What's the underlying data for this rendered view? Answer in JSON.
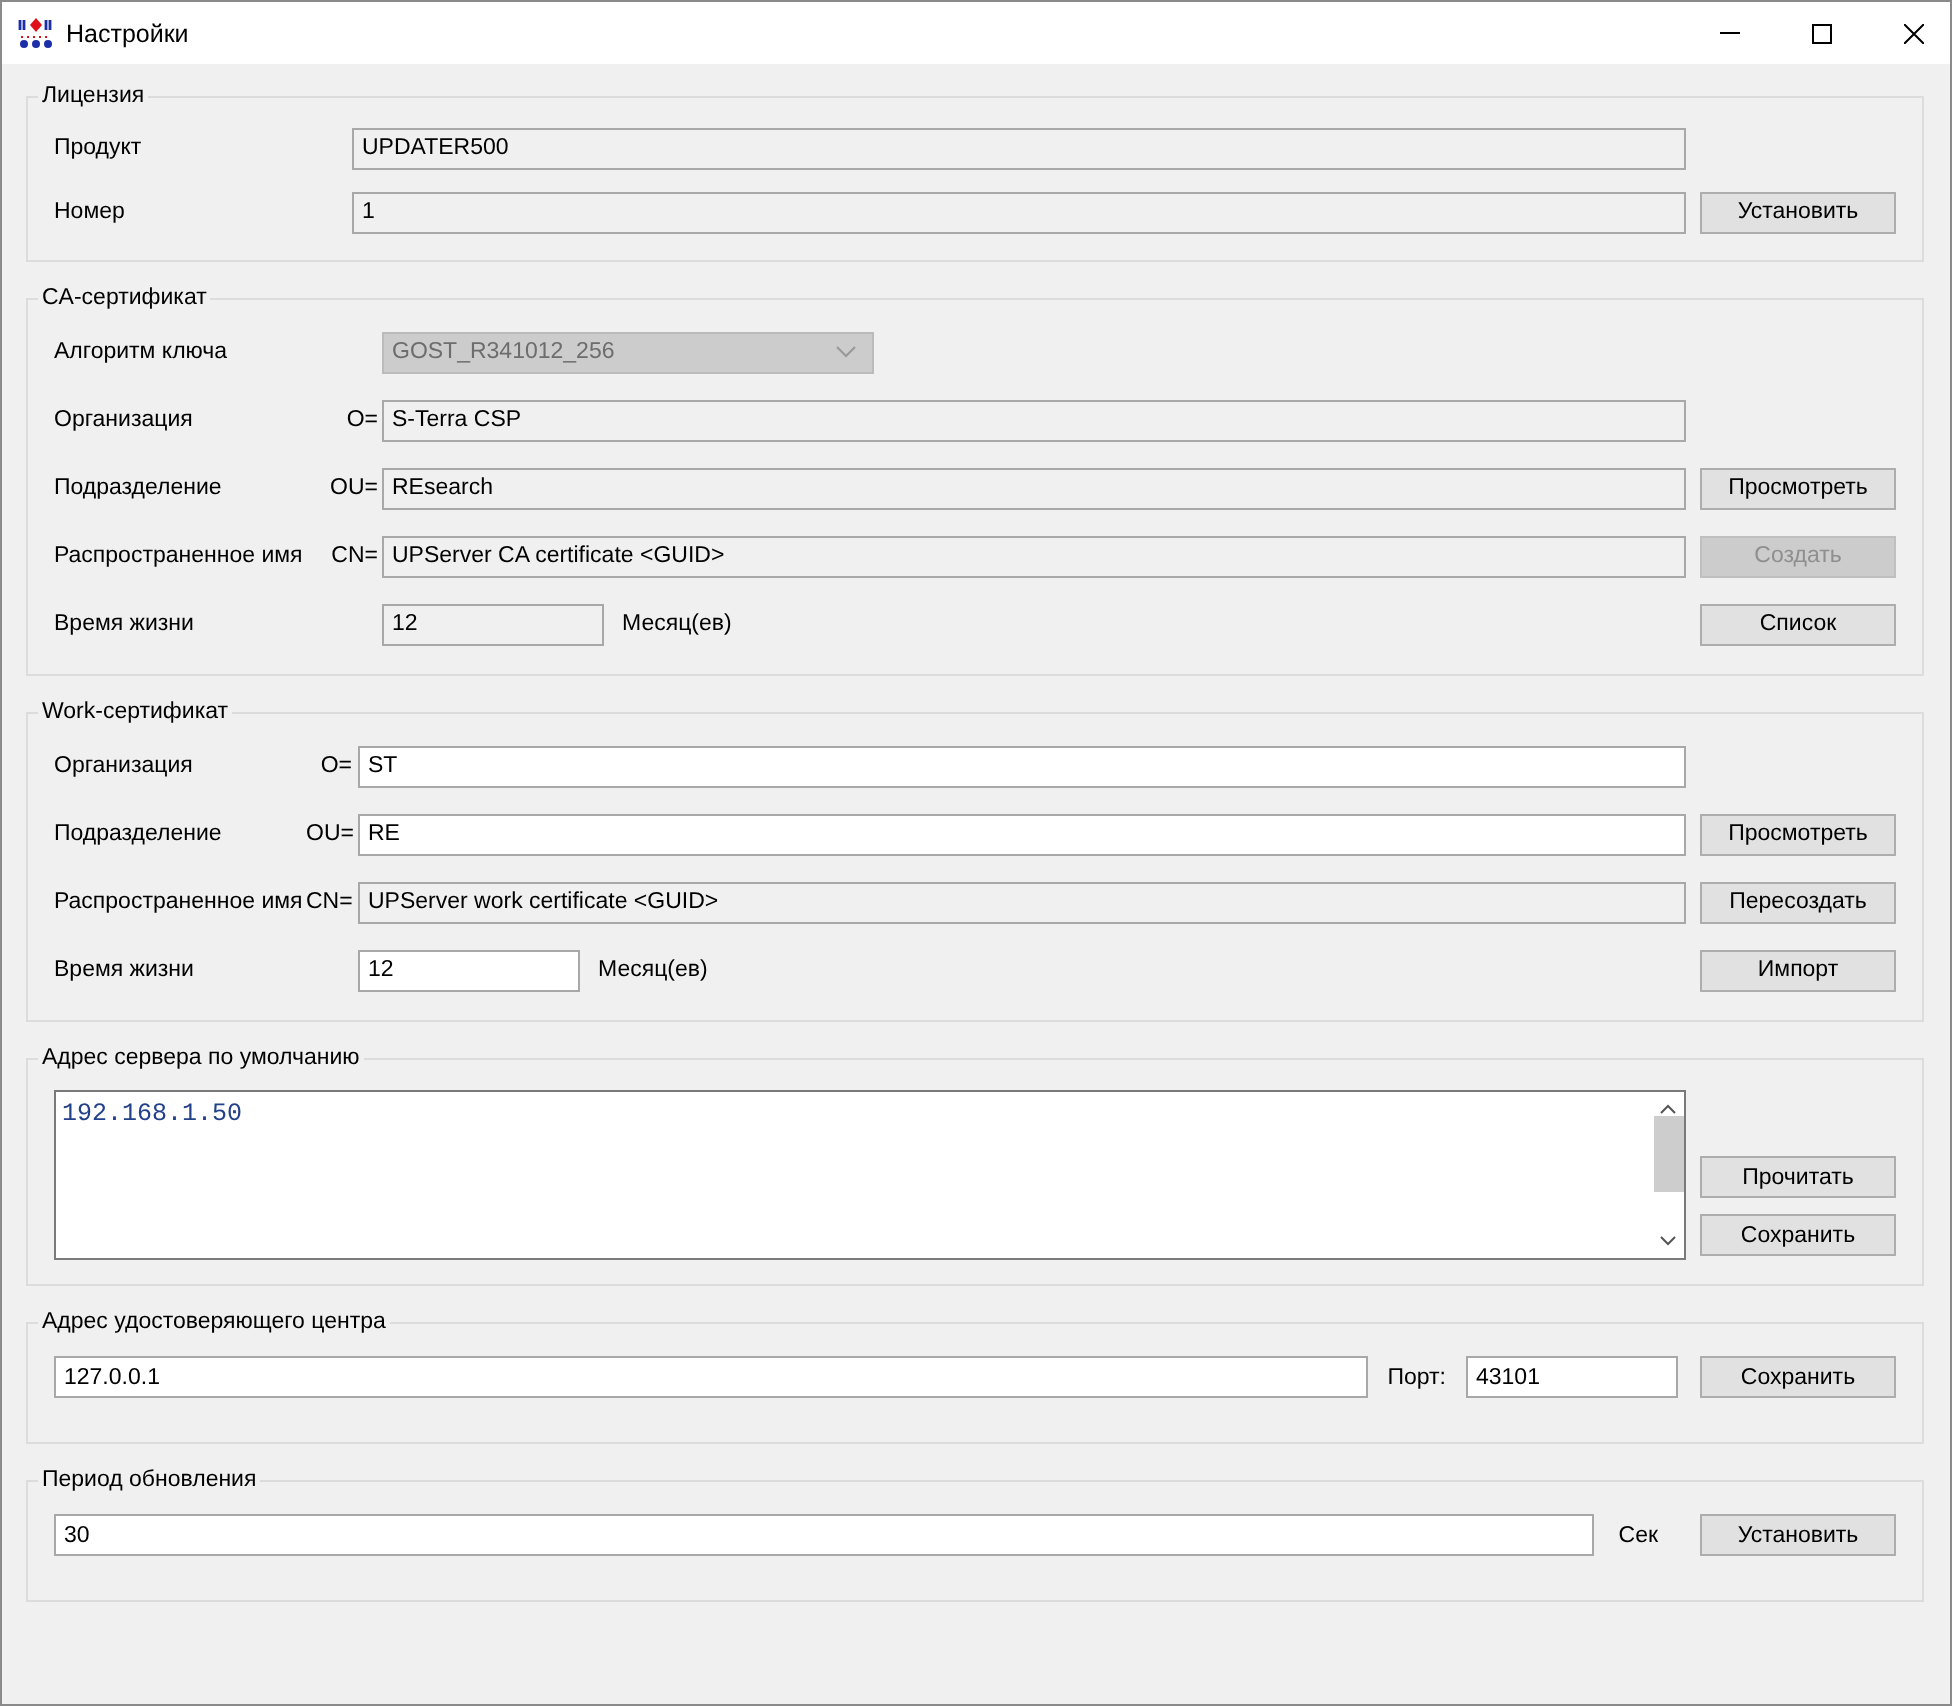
{
  "window": {
    "title": "Настройки"
  },
  "sections": [
    {
      "kind": "form",
      "title": "Лицензия",
      "rows": [
        {
          "label": "Продукт",
          "field": {
            "kind": "text",
            "value": "UPDATER500",
            "readonly": true
          }
        },
        {
          "label": "Номер",
          "field": {
            "kind": "text",
            "value": "1",
            "readonly": true
          },
          "button": {
            "label": "Установить",
            "disabled": false
          }
        }
      ]
    },
    {
      "kind": "form",
      "title": "CA-сертификат",
      "rows": [
        {
          "label": "Алгоритм ключа",
          "field": {
            "kind": "combo",
            "value": "GOST_R341012_256",
            "readonly": true
          }
        },
        {
          "label": "Организация",
          "prefix": "O=",
          "field": {
            "kind": "text",
            "value": "S-Terra CSP",
            "readonly": true
          }
        },
        {
          "label": "Подразделение",
          "prefix": "OU=",
          "field": {
            "kind": "text",
            "value": "REsearch",
            "readonly": true
          },
          "button": {
            "label": "Просмотреть",
            "disabled": false
          }
        },
        {
          "label": "Распространенное имя",
          "prefix": "CN=",
          "field": {
            "kind": "text",
            "value": "UPServer CA certificate <GUID>",
            "readonly": true
          },
          "button": {
            "label": "Создать",
            "disabled": true
          }
        },
        {
          "label": "Время жизни",
          "field": {
            "kind": "short",
            "value": "12",
            "readonly": true
          },
          "unit": "Месяц(ев)",
          "button": {
            "label": "Список",
            "disabled": false
          }
        }
      ]
    },
    {
      "kind": "form",
      "title": "Work-сертификат",
      "rows": [
        {
          "label": "Организация",
          "prefix": "O=",
          "field": {
            "kind": "text",
            "value": "ST",
            "readonly": false
          }
        },
        {
          "label": "Подразделение",
          "prefix": "OU=",
          "field": {
            "kind": "text",
            "value": "RE",
            "readonly": false
          },
          "button": {
            "label": "Просмотреть",
            "disabled": false
          }
        },
        {
          "label": "Распространенное имя",
          "prefix": "CN=",
          "field": {
            "kind": "text",
            "value": "UPServer work certificate <GUID>",
            "readonly": true
          },
          "button": {
            "label": "Пересоздать",
            "disabled": false
          }
        },
        {
          "label": "Время жизни",
          "field": {
            "kind": "short",
            "value": "12",
            "readonly": false
          },
          "unit": "Месяц(ев)",
          "button": {
            "label": "Импорт",
            "disabled": false
          }
        }
      ]
    },
    {
      "kind": "memo",
      "title": "Адрес сервера по умолчанию",
      "value": "192.168.1.50",
      "buttons": [
        {
          "label": "Прочитать",
          "disabled": false
        },
        {
          "label": "Сохранить",
          "disabled": false
        }
      ]
    },
    {
      "kind": "address",
      "title": "Адрес удостоверяющего центра",
      "value": "127.0.0.1",
      "port_label": "Порт:",
      "port": "43101",
      "button": {
        "label": "Сохранить",
        "disabled": false
      }
    },
    {
      "kind": "period",
      "title": "Период обновления",
      "value": "30",
      "unit": "Сек",
      "button": {
        "label": "Установить",
        "disabled": false
      }
    }
  ]
}
